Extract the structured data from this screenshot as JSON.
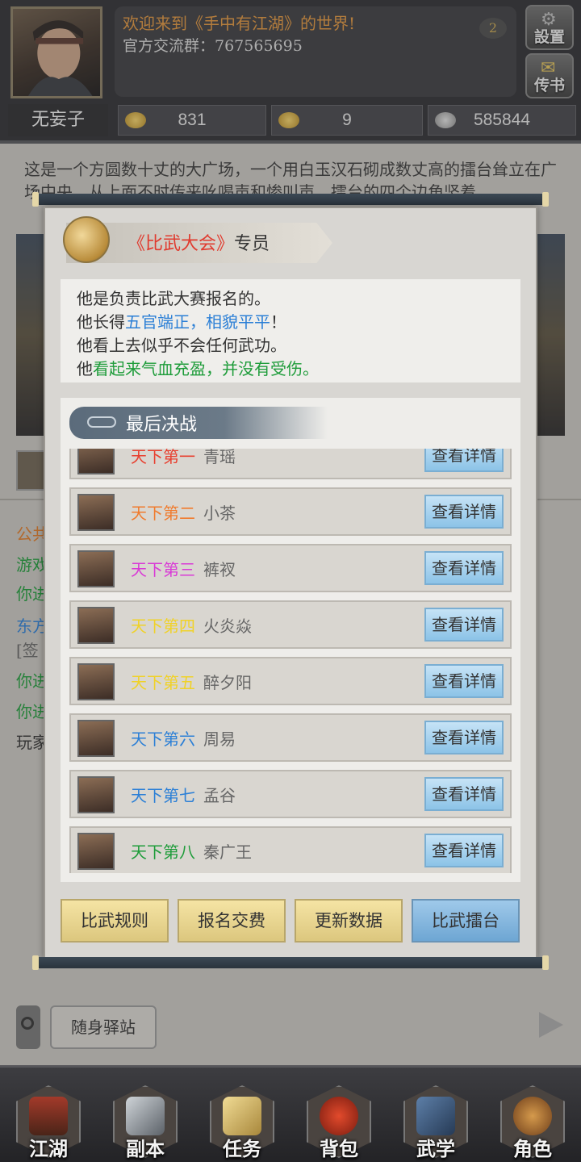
{
  "header": {
    "welcome": "欢迎来到《手中有江湖》的世界!",
    "group": "官方交流群：767565695",
    "message_count": "2",
    "settings_label": "設置",
    "mail_label": "传书",
    "player_name": "无妄子",
    "currency": [
      {
        "icon": "gold-ingot-icon",
        "value": "831"
      },
      {
        "icon": "gold-ingot-icon",
        "value": "9"
      },
      {
        "icon": "silver-ingot-icon",
        "value": "585844"
      }
    ]
  },
  "scene": {
    "description": "这是一个方圆数十丈的大广场，一个用白玉汉石砌成数丈高的擂台耸立在广场中央，从上面不时传来吆喝声和惨叫声，擂台的四个边角竖着",
    "chat_lines": [
      "公共",
      "游戏",
      "你进",
      "东方",
      "[签",
      "你进",
      "你进",
      "玩家"
    ],
    "station_label": "随身驿站"
  },
  "modal": {
    "title_highlight": "《比武大会》",
    "title_rest": "专员",
    "desc": {
      "line1": "他是负责比武大赛报名的。",
      "line2_pre": "他长得",
      "line2_hl": "五官端正，相貌平平",
      "line2_post": "！",
      "line3": "他看上去似乎不会任何武功。",
      "line4_pre": "他",
      "line4_hl": "看起来气血充盈，并没有受伤。"
    },
    "final_title": "最后决战",
    "detail_label": "查看详情",
    "rows": [
      {
        "rank": "天下第一",
        "name": "青瑶",
        "color": "#e8402f"
      },
      {
        "rank": "天下第二",
        "name": "小茶",
        "color": "#f07b2d"
      },
      {
        "rank": "天下第三",
        "name": "裤衩",
        "color": "#d93ad6"
      },
      {
        "rank": "天下第四",
        "name": "火炎焱",
        "color": "#f0d228"
      },
      {
        "rank": "天下第五",
        "name": "醉夕阳",
        "color": "#f0d228"
      },
      {
        "rank": "天下第六",
        "name": "周易",
        "color": "#2b7fd6"
      },
      {
        "rank": "天下第七",
        "name": "孟谷",
        "color": "#2b7fd6"
      },
      {
        "rank": "天下第八",
        "name": "秦广王",
        "color": "#1e9c3a"
      }
    ],
    "buttons": {
      "rules": "比武规则",
      "signup": "报名交费",
      "refresh": "更新数据",
      "arena": "比武擂台"
    }
  },
  "nav": [
    {
      "label": "江湖",
      "icon": "pagoda-icon"
    },
    {
      "label": "副本",
      "icon": "swords-icon"
    },
    {
      "label": "任务",
      "icon": "scroll-icon"
    },
    {
      "label": "背包",
      "icon": "bag-icon"
    },
    {
      "label": "武学",
      "icon": "book-icon"
    },
    {
      "label": "角色",
      "icon": "gourd-icon"
    }
  ]
}
